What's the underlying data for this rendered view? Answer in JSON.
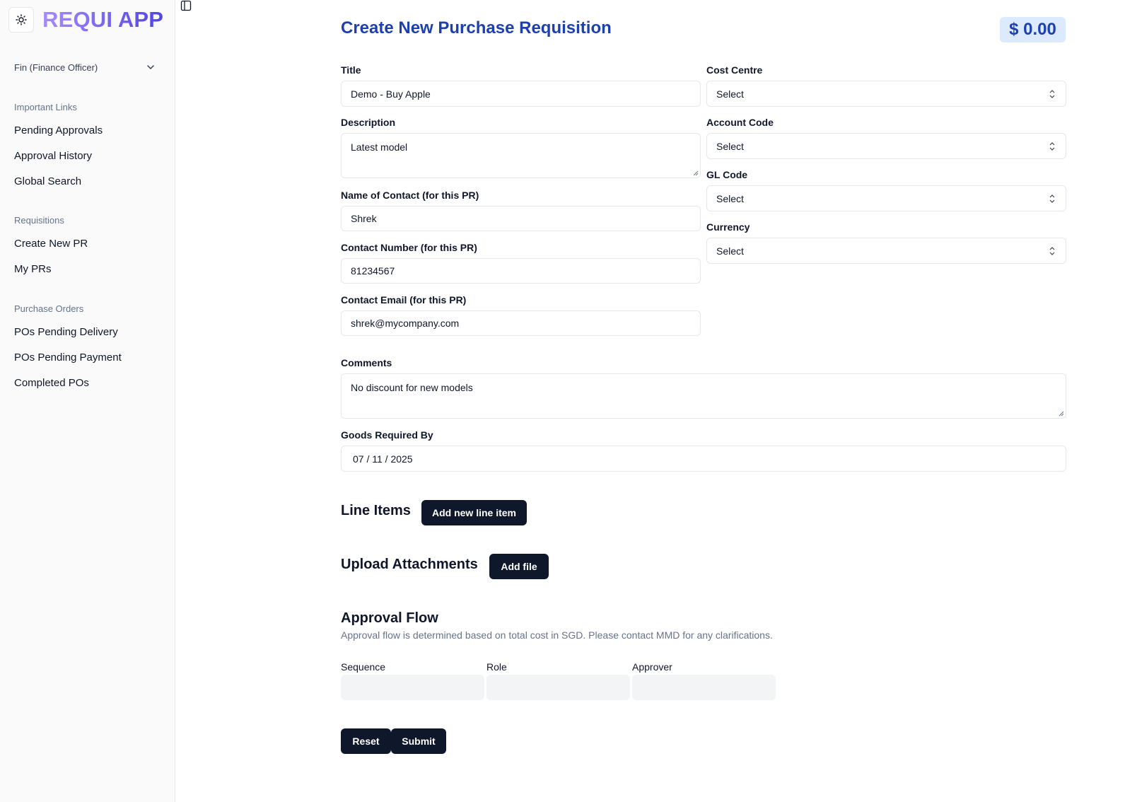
{
  "app": {
    "name": "REQUI APP"
  },
  "sidebar": {
    "user": "Fin (Finance Officer)",
    "sections": [
      {
        "title": "Important Links",
        "items": [
          "Pending Approvals",
          "Approval History",
          "Global Search"
        ]
      },
      {
        "title": "Requisitions",
        "items": [
          "Create New PR",
          "My PRs"
        ]
      },
      {
        "title": "Purchase Orders",
        "items": [
          "POs Pending Delivery",
          "POs Pending Payment",
          "Completed POs"
        ]
      }
    ]
  },
  "header": {
    "title": "Create New Purchase Requisition",
    "total": "$ 0.00"
  },
  "form": {
    "title": {
      "label": "Title",
      "value": "Demo - Buy Apple"
    },
    "description": {
      "label": "Description",
      "value": "Latest model"
    },
    "contact_name": {
      "label": "Name of Contact (for this PR)",
      "value": "Shrek"
    },
    "contact_number": {
      "label": "Contact Number (for this PR)",
      "value": "81234567"
    },
    "contact_email": {
      "label": "Contact Email (for this PR)",
      "value": "shrek@mycompany.com"
    },
    "cost_centre": {
      "label": "Cost Centre",
      "value": "Select"
    },
    "account_code": {
      "label": "Account Code",
      "value": "Select"
    },
    "gl_code": {
      "label": "GL Code",
      "value": "Select"
    },
    "currency": {
      "label": "Currency",
      "value": "Select"
    },
    "comments": {
      "label": "Comments",
      "value": "No discount for new models"
    },
    "required_by": {
      "label": "Goods Required By",
      "value": "07 / 11 / 2025"
    }
  },
  "line_items": {
    "heading": "Line Items",
    "button": "Add new line item"
  },
  "attachments": {
    "heading": "Upload Attachments",
    "button": "Add file"
  },
  "approval_flow": {
    "heading": "Approval Flow",
    "note": "Approval flow is determined based on total cost in SGD. Please contact MMD for any clarifications.",
    "columns": [
      "Sequence",
      "Role",
      "Approver"
    ]
  },
  "actions": {
    "reset": "Reset",
    "submit": "Submit"
  }
}
